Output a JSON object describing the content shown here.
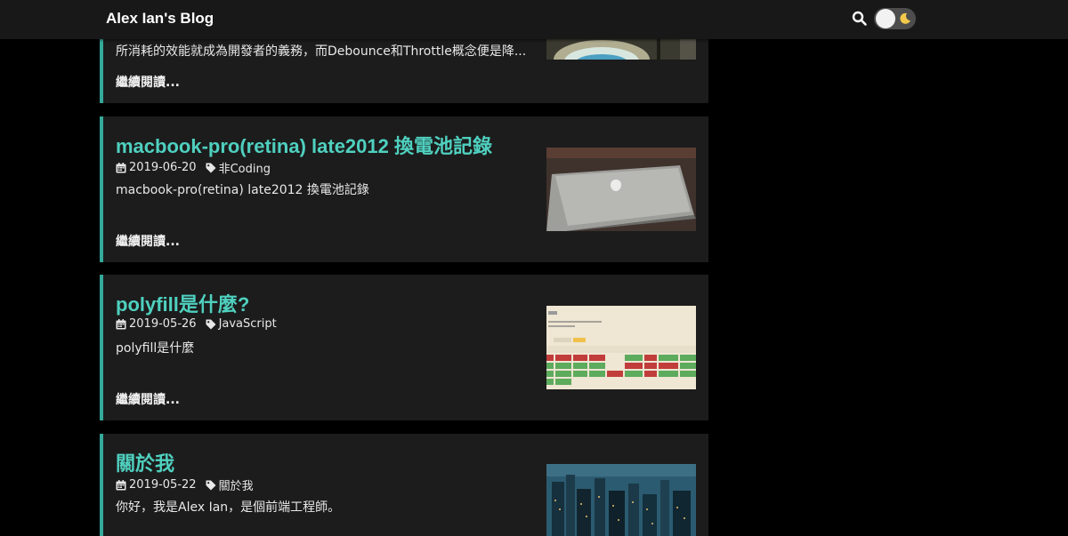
{
  "header": {
    "brand": "Alex Ian's Blog",
    "search_icon": "search-icon",
    "theme_toggle_icon": "moon-icon"
  },
  "posts": [
    {
      "excerpt": "所消耗的效能就成為開發者的義務，而Debounce和Throttle概念便是降...",
      "read_more": "繼續閱讀..."
    },
    {
      "title": "macbook-pro(retina) late2012 換電池記錄",
      "date": "2019-06-20",
      "tag": "非Coding",
      "excerpt": "macbook-pro(retina) late2012 換電池記錄",
      "read_more": "繼續閱讀..."
    },
    {
      "title": "polyfill是什麼?",
      "date": "2019-05-26",
      "tag": "JavaScript",
      "excerpt": "polyfill是什麼",
      "read_more": "繼續閱讀..."
    },
    {
      "title": "關於我",
      "date": "2019-05-22",
      "tag": "關於我",
      "excerpt": "你好，我是Alex Ian，是個前端工程師。"
    }
  ],
  "colors": {
    "accent": "#4fd0bf",
    "card_border": "#35a99b",
    "card_bg": "#1c1c1c",
    "page_bg": "#000000",
    "header_bg": "#181818"
  }
}
